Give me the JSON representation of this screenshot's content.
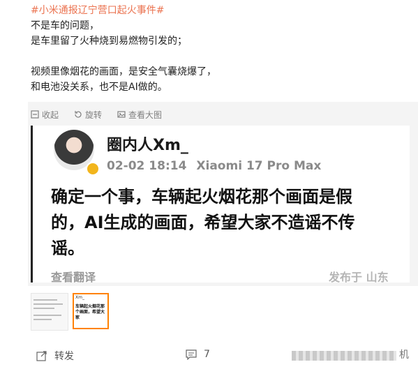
{
  "post": {
    "hashtag": "#小米通报辽宁营口起火事件#",
    "line1": "不是车的问题，",
    "line2": "是车里留了火种烧到易燃物引发的；",
    "line3": "视频里像烟花的画面，是安全气囊烧爆了，",
    "line4": "和电池没关系，也不是AI做的。"
  },
  "media_actions": {
    "collect": "收起",
    "rotate": "旋转",
    "view_large": "查看大图"
  },
  "embedded": {
    "author": "圈内人Xm_",
    "timestamp": "02-02 18:14",
    "device": "Xiaomi 17 Pro Max",
    "body_line1": "确定一个事，车辆起火烟花那个画面是假",
    "body_line2": "的，AI生成的画面，希望大家不造谣不传",
    "body_line3": "谣。",
    "translate": "查看翻译",
    "watermark": "发布于 山东"
  },
  "thumbs": [
    {
      "head": ""
    },
    {
      "head": "Xm_",
      "text": "车辆起火烟花那个画面，希望大家"
    }
  ],
  "footer": {
    "repost": "转发",
    "comments": "7",
    "tail": "机"
  },
  "colors": {
    "hashtag": "#eb7350",
    "selected_thumb": "#ff8200",
    "badge": "#f2b51c"
  }
}
